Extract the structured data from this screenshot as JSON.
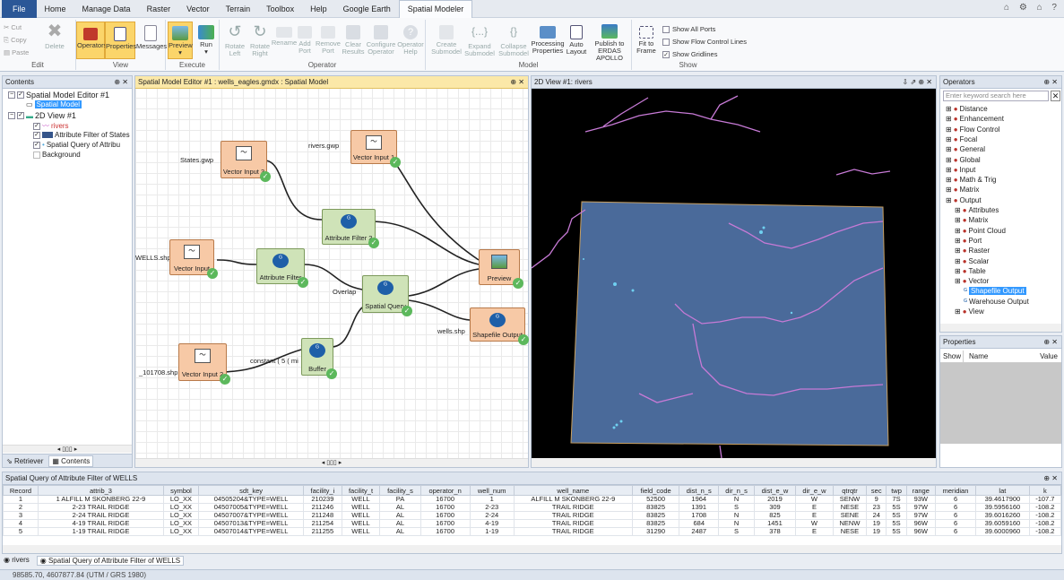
{
  "menu": {
    "items": [
      "File",
      "Home",
      "Manage Data",
      "Raster",
      "Vector",
      "Terrain",
      "Toolbox",
      "Help",
      "Google Earth",
      "Spatial Modeler"
    ]
  },
  "ribbon": {
    "edit": {
      "cut": "Cut",
      "copy": "Copy",
      "paste": "Paste",
      "delete": "Delete",
      "label": "Edit"
    },
    "view": {
      "operators": "Operators",
      "properties": "Properties",
      "messages": "Messages",
      "label": "View"
    },
    "execute": {
      "preview": "Preview",
      "run": "Run",
      "label": "Execute"
    },
    "operator": {
      "rotate_left": "Rotate Left",
      "rotate_right": "Rotate Right",
      "rename": "Rename",
      "add_port": "Add Port",
      "remove_port": "Remove Port",
      "clear_results": "Clear Results",
      "configure": "Configure Operator",
      "help": "Operator Help",
      "label": "Operator"
    },
    "model": {
      "create": "Create Submodel",
      "expand": "Expand Submodel",
      "collapse": "Collapse Submodel",
      "processing": "Processing Properties",
      "auto": "Auto Layout",
      "publish": "Publish to ERDAS APOLLO",
      "label": "Model"
    },
    "show": {
      "fit": "Fit to Frame",
      "all_ports": "Show All Ports",
      "flow_lines": "Show Flow Control Lines",
      "gridlines": "Show Gridlines",
      "label": "Show"
    }
  },
  "contents": {
    "title": "Contents",
    "items": [
      "Spatial Model Editor #1",
      "Spatial Model",
      "2D View #1",
      "rivers",
      "Attribute Filter of States",
      "Spatial Query of Attribu",
      "Background"
    ],
    "tab_retriever": "Retriever",
    "tab_contents": "Contents"
  },
  "editor": {
    "title": "Spatial Model Editor #1 : wells_eagles.gmdx : Spatial Model",
    "nodes": {
      "vi3": "Vector Input 3",
      "vi1": "Vector Input 1",
      "vi": "Vector Input",
      "vi2": "Vector Input 2",
      "af2": "Attribute Filter 2",
      "af": "Attribute Filter",
      "sq": "Spatial Query",
      "buf": "Buffer",
      "prev": "Preview",
      "shp": "Shapefile Output"
    },
    "ports": {
      "states": "States.gwp",
      "rivers": "rivers.gwp",
      "wells": "WELLS.shp",
      "wells101": "_101708.shp",
      "overlap": "Overlap",
      "wellsout": "wells.shp",
      "constant": "constant ( 5 ( mi"
    }
  },
  "view2d": {
    "title": "2D View #1: rivers"
  },
  "operators": {
    "title": "Operators",
    "search_placeholder": "Enter keyword search here",
    "items": [
      "Distance",
      "Enhancement",
      "Flow Control",
      "Focal",
      "General",
      "Global",
      "Input",
      "Math & Trig",
      "Matrix",
      "Output",
      "Attributes",
      "Matrix",
      "Point Cloud",
      "Port",
      "Raster",
      "Scalar",
      "Table",
      "Vector",
      "Shapefile Output",
      "Warehouse Output",
      "View"
    ]
  },
  "properties": {
    "title": "Properties",
    "col_show": "Show",
    "col_name": "Name",
    "col_value": "Value"
  },
  "table": {
    "title": "Spatial Query of Attribute Filter of WELLS",
    "columns": [
      "Record",
      "attrib_3",
      "symbol",
      "sdt_key",
      "facility_i",
      "facility_t",
      "facility_s",
      "operator_n",
      "well_num",
      "well_name",
      "field_code",
      "dist_n_s",
      "dir_n_s",
      "dist_e_w",
      "dir_e_w",
      "qtrqtr",
      "sec",
      "twp",
      "range",
      "meridian",
      "lat",
      "k"
    ],
    "rows": [
      [
        "1",
        "1 ALFILL M SKONBERG 22-9",
        "LO_XX",
        "04505204&TYPE=WELL",
        "210239",
        "WELL",
        "PA",
        "16700",
        "1",
        "ALFILL M SKONBERG 22-9",
        "52500",
        "1964",
        "N",
        "2019",
        "W",
        "SENW",
        "9",
        "7S",
        "93W",
        "6",
        "39.4617900",
        "-107.7"
      ],
      [
        "2",
        "2-23 TRAIL RIDGE",
        "LO_XX",
        "04507005&TYPE=WELL",
        "211246",
        "WELL",
        "AL",
        "16700",
        "2-23",
        "TRAIL RIDGE",
        "83825",
        "1391",
        "S",
        "309",
        "E",
        "NESE",
        "23",
        "5S",
        "97W",
        "6",
        "39.5956160",
        "-108.2"
      ],
      [
        "3",
        "2-24 TRAIL RIDGE",
        "LO_XX",
        "04507007&TYPE=WELL",
        "211248",
        "WELL",
        "AL",
        "16700",
        "2-24",
        "TRAIL RIDGE",
        "83825",
        "1708",
        "N",
        "825",
        "E",
        "SENE",
        "24",
        "5S",
        "97W",
        "6",
        "39.6016260",
        "-108.2"
      ],
      [
        "4",
        "4-19 TRAIL RIDGE",
        "LO_XX",
        "04507013&TYPE=WELL",
        "211254",
        "WELL",
        "AL",
        "16700",
        "4-19",
        "TRAIL RIDGE",
        "83825",
        "684",
        "N",
        "1451",
        "W",
        "NENW",
        "19",
        "5S",
        "96W",
        "6",
        "39.6059160",
        "-108.2"
      ],
      [
        "5",
        "1-19 TRAIL RIDGE",
        "LO_XX",
        "04507014&TYPE=WELL",
        "211255",
        "WELL",
        "AL",
        "16700",
        "1-19",
        "TRAIL RIDGE",
        "31290",
        "2487",
        "S",
        "378",
        "E",
        "NESE",
        "19",
        "5S",
        "96W",
        "6",
        "39.6000960",
        "-108.2"
      ]
    ]
  },
  "bottom_tabs": {
    "rivers": "rivers",
    "sq": "Spatial Query of Attribute Filter of WELLS"
  },
  "status": {
    "coords": "98585.70, 4607877.84  (UTM / GRS 1980)"
  }
}
